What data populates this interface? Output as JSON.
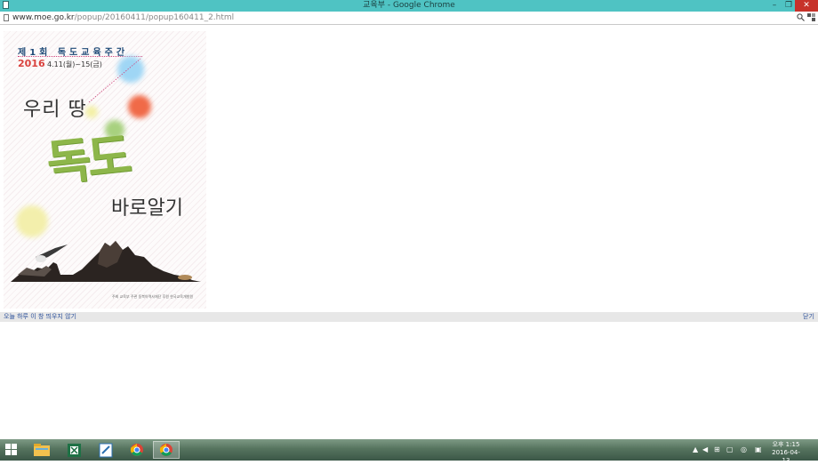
{
  "window": {
    "title": "교육부 - Google Chrome",
    "minimize_glyph": "–",
    "maximize_glyph": "❐",
    "close_glyph": "✕"
  },
  "address": {
    "url_host": "www.moe.go.kr",
    "url_path": "/popup/20160411/popup160411_2.html"
  },
  "poster": {
    "edition": "제1회 독도교육주간",
    "year": "2016",
    "dates": "4.11(월)~15(금)",
    "line1": "우리 땅",
    "headline": "독도",
    "line3": "바로알기",
    "logos_text": "주최 교육부   주관 동북아역사재단   후원 한국교육개발원"
  },
  "popup_bar": {
    "dismiss_today": "오늘 하루 이 창 띄우지 않기",
    "close": "닫기"
  },
  "taskbar": {
    "apps": [
      "start",
      "file-explorer",
      "excel",
      "notepad-app",
      "chrome",
      "chrome-active"
    ],
    "clock_time": "오후 1:15",
    "clock_date": "2016-04-13"
  }
}
